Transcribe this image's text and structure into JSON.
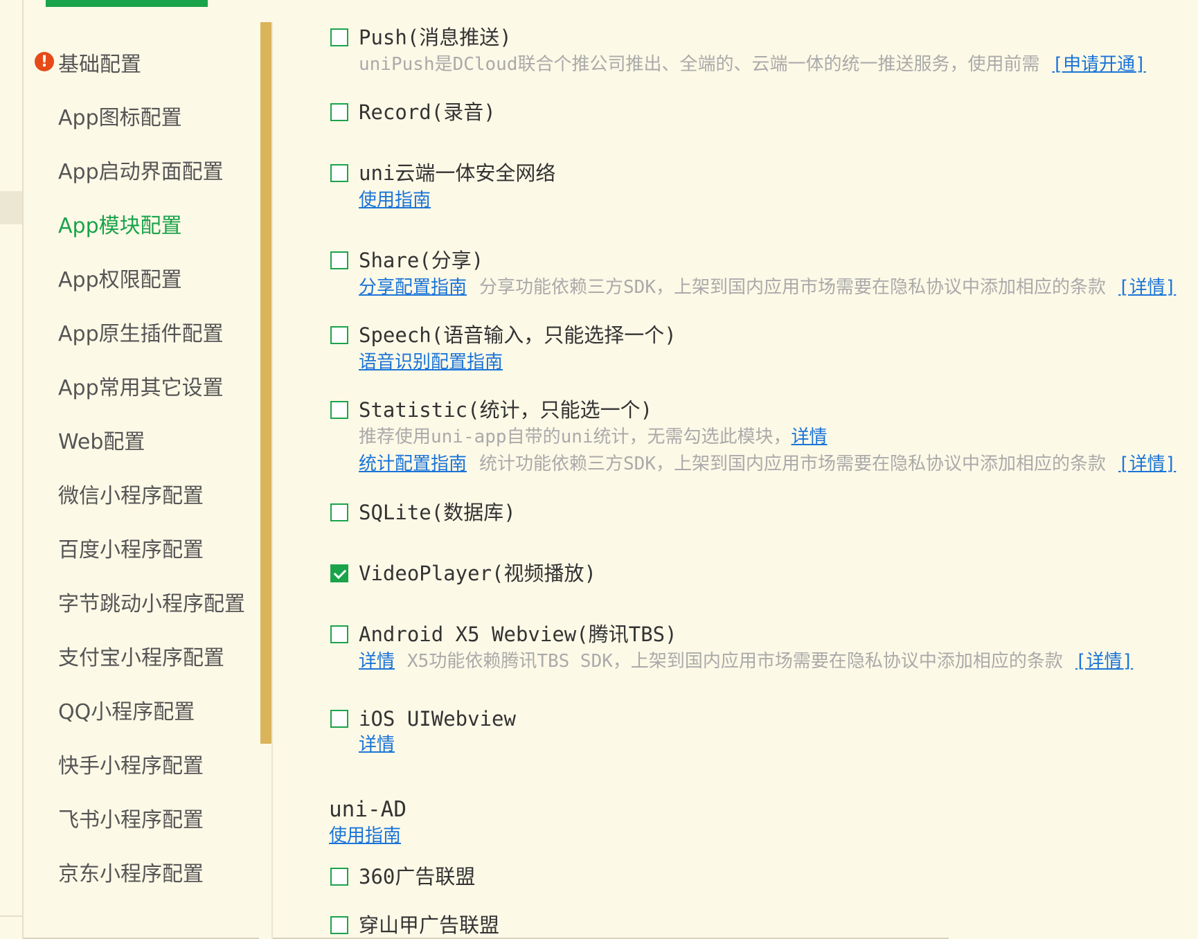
{
  "sidebar": {
    "items": [
      {
        "label": "基础配置"
      },
      {
        "label": "App图标配置"
      },
      {
        "label": "App启动界面配置"
      },
      {
        "label": "App模块配置"
      },
      {
        "label": "App权限配置"
      },
      {
        "label": "App原生插件配置"
      },
      {
        "label": "App常用其它设置"
      },
      {
        "label": "Web配置"
      },
      {
        "label": "微信小程序配置"
      },
      {
        "label": "百度小程序配置"
      },
      {
        "label": "字节跳动小程序配置"
      },
      {
        "label": "支付宝小程序配置"
      },
      {
        "label": "QQ小程序配置"
      },
      {
        "label": "快手小程序配置"
      },
      {
        "label": "飞书小程序配置"
      },
      {
        "label": "京东小程序配置"
      }
    ],
    "active_index": 3,
    "warning_icon": "exclamation-icon",
    "active_color": "#1aa34a"
  },
  "modules": {
    "push": {
      "title": "Push(消息推送)",
      "checked": false,
      "desc": "uniPush是DCloud联合个推公司推出、全端的、云端一体的统一推送服务，使用前需",
      "link": "[申请开通]"
    },
    "record": {
      "title": "Record(录音)",
      "checked": false
    },
    "uni_secure": {
      "title": "uni云端一体安全网络",
      "checked": false,
      "link": "使用指南"
    },
    "share": {
      "title": "Share(分享)",
      "checked": false,
      "link": "分享配置指南",
      "desc": "分享功能依赖三方SDK，上架到国内应用市场需要在隐私协议中添加相应的条款",
      "detail": "[详情]"
    },
    "speech": {
      "title": "Speech(语音输入，只能选择一个)",
      "checked": false,
      "link": "语音识别配置指南"
    },
    "statistic": {
      "title": "Statistic(统计，只能选一个)",
      "checked": false,
      "desc1": "推荐使用uni-app自带的uni统计，无需勾选此模块，",
      "desc1_link": "详情",
      "link": "统计配置指南",
      "desc2": "统计功能依赖三方SDK，上架到国内应用市场需要在隐私协议中添加相应的条款",
      "detail": "[详情]"
    },
    "sqlite": {
      "title": "SQLite(数据库)",
      "checked": false
    },
    "videoplayer": {
      "title": "VideoPlayer(视频播放)",
      "checked": true
    },
    "x5": {
      "title": "Android X5 Webview(腾讯TBS)",
      "checked": false,
      "link": "详情",
      "desc": "X5功能依赖腾讯TBS SDK，上架到国内应用市场需要在隐私协议中添加相应的条款",
      "detail": "[详情]"
    },
    "ios_uiwebview": {
      "title": "iOS UIWebview",
      "checked": false,
      "link": "详情"
    }
  },
  "uni_ad": {
    "title": "uni-AD",
    "link": "使用指南",
    "items": [
      {
        "title": "360广告联盟",
        "checked": false
      },
      {
        "title": "穿山甲广告联盟",
        "checked": false
      }
    ]
  },
  "colors": {
    "accent": "#1aa34a",
    "link": "#1a74d8",
    "warning": "#e64a19",
    "scrollbar": "#d9b45a"
  }
}
